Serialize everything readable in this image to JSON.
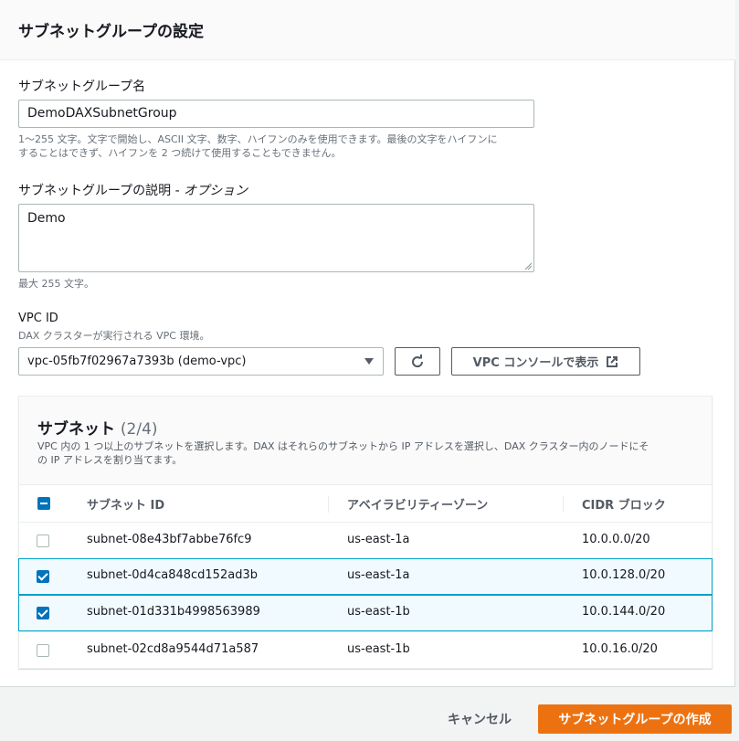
{
  "panel": {
    "title": "サブネットグループの設定"
  },
  "name_field": {
    "label": "サブネットグループ名",
    "value": "DemoDAXSubnetGroup",
    "hint_line1": "1〜255 文字。文字で開始し、ASCII 文字、数字、ハイフンのみを使用できます。最後の文字をハイフンに",
    "hint_line2": "することはできず、ハイフンを 2 つ続けて使用することもできません。"
  },
  "description_field": {
    "label": "サブネットグループの説明 - ",
    "label_optional": "オプション",
    "value": "Demo",
    "hint": "最大 255 文字。"
  },
  "vpc": {
    "label": "VPC ID",
    "hint": "DAX クラスターが実行される VPC 環境。",
    "selected": "vpc-05fb7f02967a7393b (demo-vpc)",
    "refresh_icon": "refresh-icon",
    "console_button": "VPC コンソールで表示",
    "external_icon": "external-link-icon"
  },
  "subnets": {
    "title": "サブネット",
    "count": "(2/4)",
    "desc_line1": "VPC 内の 1 つ以上のサブネットを選択します。DAX はそれらのサブネットから IP アドレスを選択し、DAX クラスター内のノードにそ",
    "desc_line2": "の IP アドレスを割り当てます。",
    "columns": [
      "サブネット ID",
      "アベイラビリティーゾーン",
      "CIDR ブロック"
    ],
    "rows": [
      {
        "id": "subnet-08e43bf7abbe76fc9",
        "az": "us-east-1a",
        "cidr": "10.0.0.0/20",
        "selected": false
      },
      {
        "id": "subnet-0d4ca848cd152ad3b",
        "az": "us-east-1a",
        "cidr": "10.0.128.0/20",
        "selected": true
      },
      {
        "id": "subnet-01d331b4998563989",
        "az": "us-east-1b",
        "cidr": "10.0.144.0/20",
        "selected": true
      },
      {
        "id": "subnet-02cd8a9544d71a587",
        "az": "us-east-1b",
        "cidr": "10.0.16.0/20",
        "selected": false
      }
    ]
  },
  "footer": {
    "cancel": "キャンセル",
    "create": "サブネットグループの作成"
  },
  "colors": {
    "primary": "#ec7211",
    "selected_row_border": "#00a1c9",
    "checkbox": "#0073bb"
  }
}
